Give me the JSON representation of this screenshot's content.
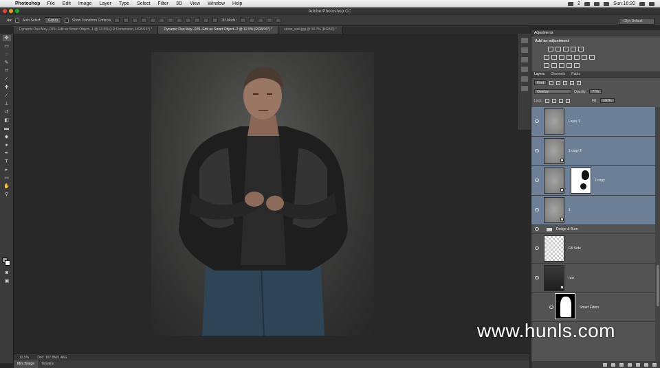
{
  "menubar": {
    "app_name": "Photoshop",
    "items": [
      "File",
      "Edit",
      "Image",
      "Layer",
      "Type",
      "Select",
      "Filter",
      "3D",
      "View",
      "Window",
      "Help"
    ],
    "clock": "Sun 16:20",
    "badge": "2"
  },
  "window": {
    "title": "Adobe Photoshop CC"
  },
  "options": {
    "auto_select_label": "Auto-Select:",
    "auto_select_value": "Group",
    "transform_controls_label": "Show Transform Controls",
    "mode_3d_label": "3D Mode:",
    "workspace": "Glyn Default"
  },
  "tabs": [
    "Dynamic Duo May--029--Edit as Smart Object--1 @ 12.5% (LR Conversion, RGB/16*) *",
    "Dynamic Duo May--029--Edit as Smart Object--2 @ 12.5% (RGB/16*) *",
    "stone_wall.jpg @ 16.7% (RGB/8) *"
  ],
  "status": {
    "zoom": "12.5%",
    "doc": "Doc: 197.8M/1.46G"
  },
  "bottom_tabs": [
    "Mini Bridge",
    "Timeline"
  ],
  "adjustments": {
    "tab_label": "Adjustments",
    "title": "Add an adjustment"
  },
  "layers_panel": {
    "tabs": [
      "Layers",
      "Channels",
      "Paths"
    ],
    "kind_label": "Kind",
    "blend_mode": "Overlay",
    "opacity_label": "Opacity:",
    "opacity_value": "77%",
    "lock_label": "Lock:",
    "fill_label": "Fill:",
    "fill_value": "100%",
    "layers": [
      {
        "name": "Layer 1"
      },
      {
        "name": "1 copy 2"
      },
      {
        "name": "1 copy"
      },
      {
        "name": "1"
      },
      {
        "name": "Dodge & Burn"
      },
      {
        "name": "Fill Side"
      },
      {
        "name": "raw"
      },
      {
        "name": "Smart Filters"
      }
    ]
  },
  "colors": {
    "accent_selected_layer": "#6d8098",
    "panel_bg": "#535353",
    "canvas_bg": "#282828"
  },
  "watermark": "www.hunls.com"
}
